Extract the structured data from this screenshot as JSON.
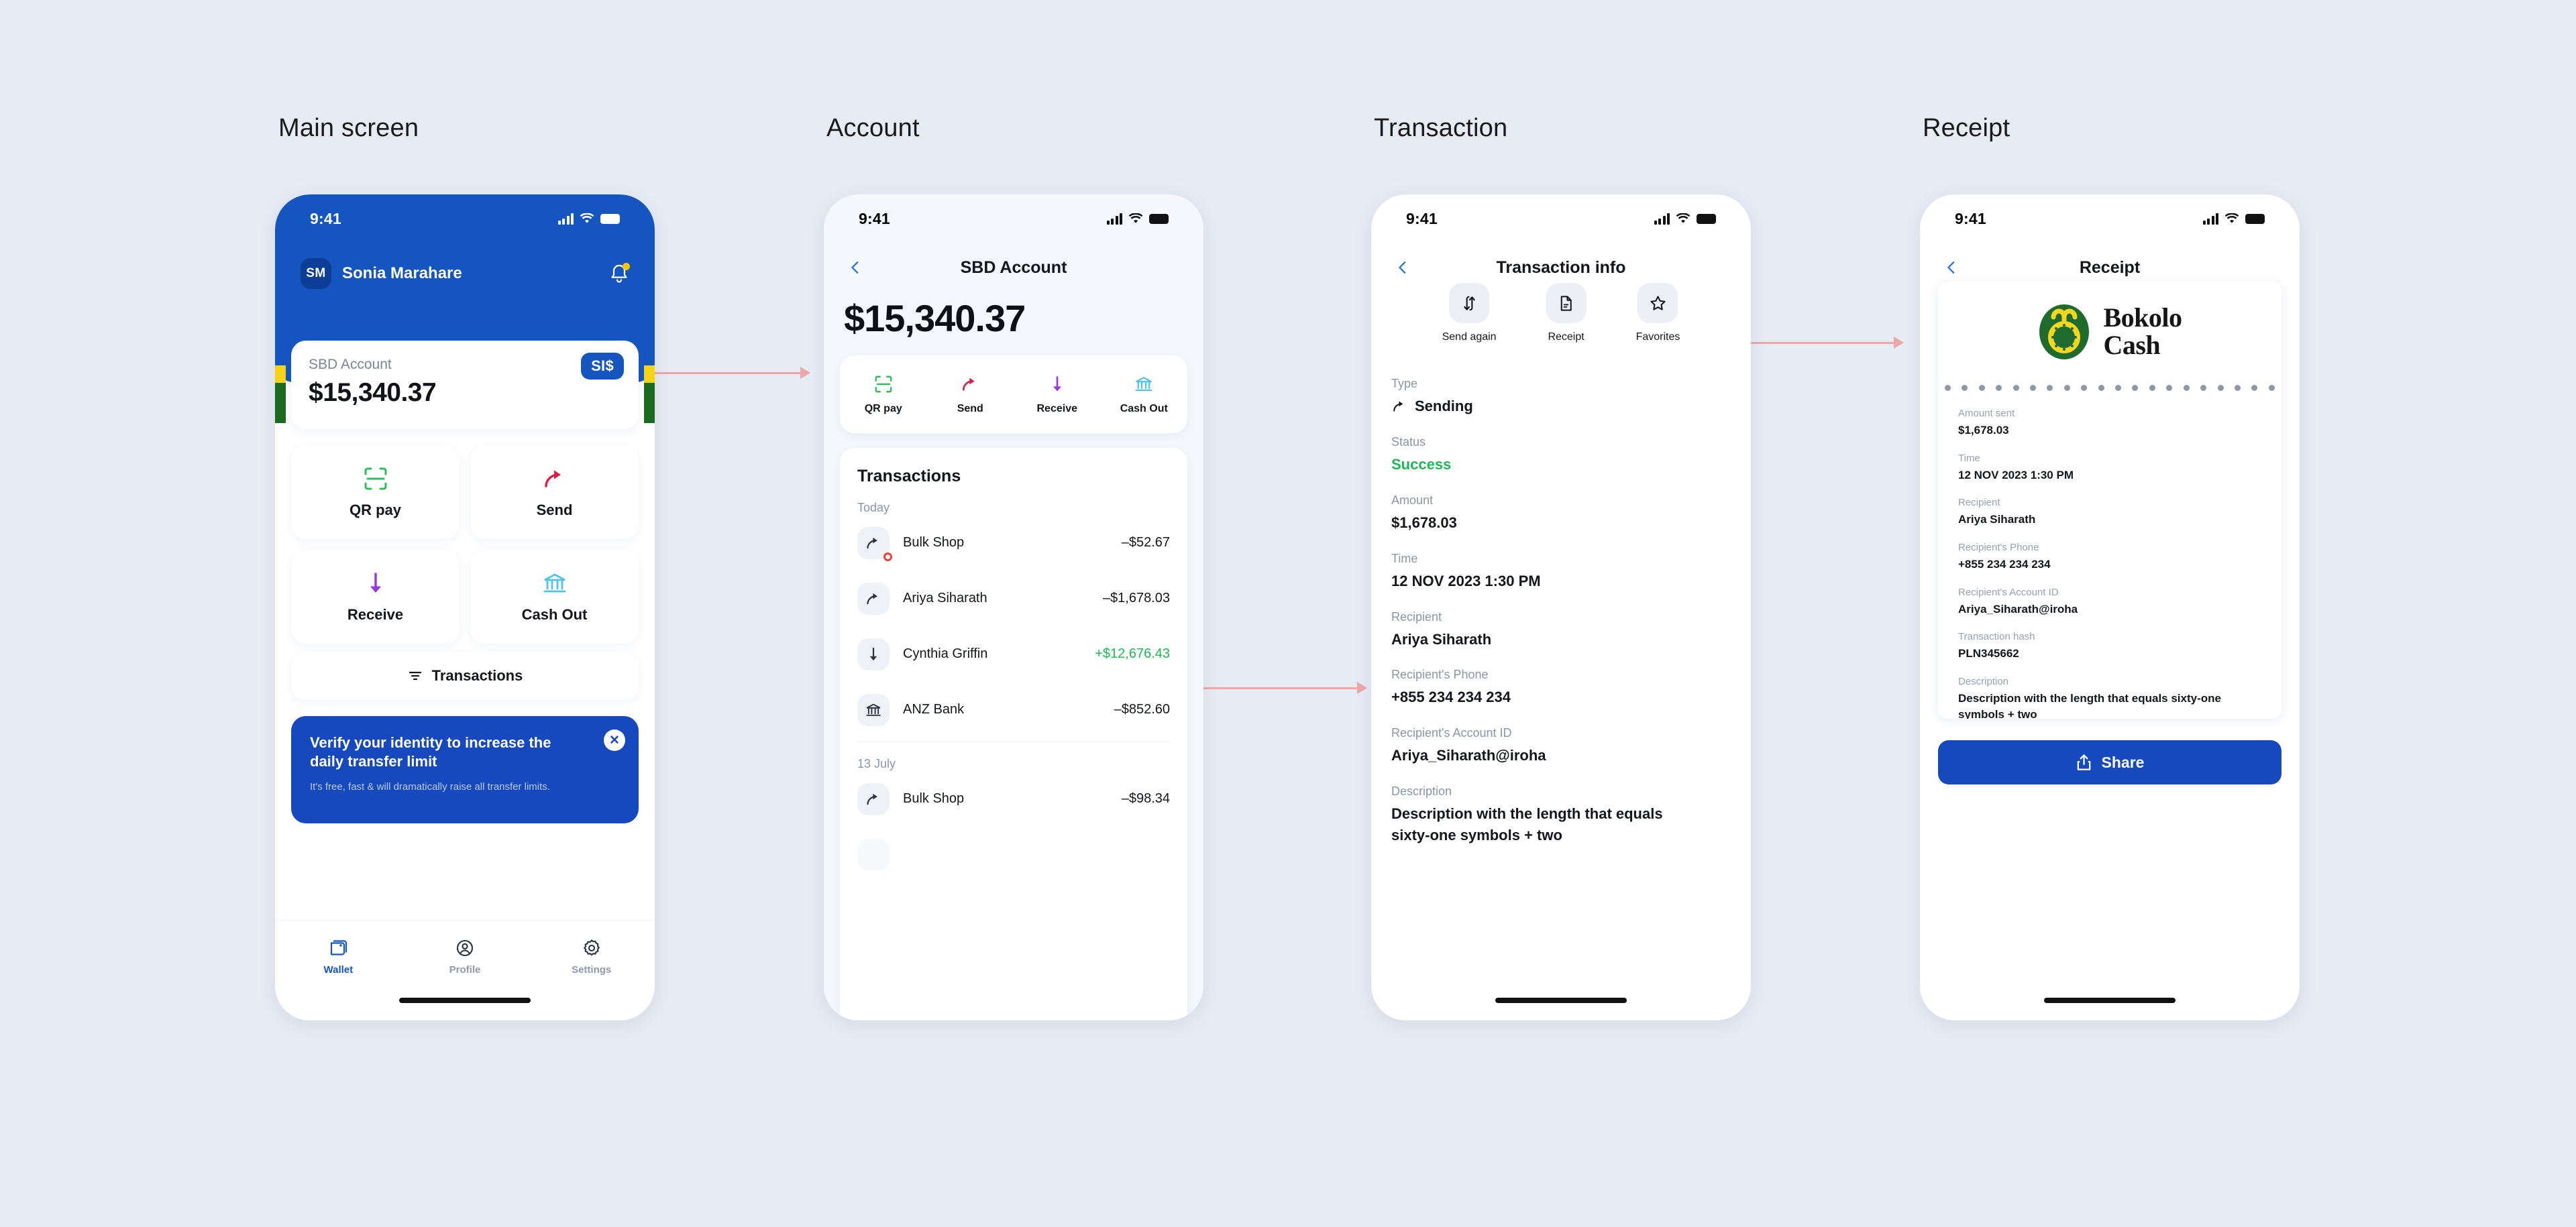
{
  "sections": [
    {
      "label": "Main screen"
    },
    {
      "label": "Account"
    },
    {
      "label": "Transaction"
    },
    {
      "label": "Receipt"
    }
  ],
  "colors": {
    "page_background": "#e6ebf4",
    "brand_blue": "#1555c0",
    "promo_blue": "#1649bd",
    "success_green": "#1db954",
    "arrow_pink": "#eda7a7",
    "flag_yellow": "#f5d312",
    "flag_green": "#1b6b1f",
    "logo_green": "#1f6b2e",
    "logo_yellow": "#f4d71d"
  },
  "status_bar": {
    "time": "9:41"
  },
  "main_screen": {
    "user": {
      "initials": "SM",
      "name": "Sonia Marahare"
    },
    "notification_icon": "bell-icon",
    "balance_card": {
      "account_label": "SBD Account",
      "amount": "$15,340.37",
      "currency_badge": "SI$"
    },
    "tiles": [
      {
        "label": "QR pay",
        "icon": "qr-scan-icon"
      },
      {
        "label": "Send",
        "icon": "send-arrow-icon"
      },
      {
        "label": "Receive",
        "icon": "receive-arrow-icon"
      },
      {
        "label": "Cash Out",
        "icon": "bank-icon"
      }
    ],
    "transactions_button": {
      "label": "Transactions",
      "icon": "filter-icon"
    },
    "promo": {
      "title": "Verify your identity to increase the daily transfer limit",
      "subtitle": "It's free, fast & will dramatically raise all transfer limits.",
      "close_icon": "close-icon"
    },
    "tab_bar": [
      {
        "label": "Wallet",
        "icon": "wallet-icon",
        "active": true
      },
      {
        "label": "Profile",
        "icon": "user-circle-icon",
        "active": false
      },
      {
        "label": "Settings",
        "icon": "gear-icon",
        "active": false
      }
    ]
  },
  "account_screen": {
    "title": "SBD Account",
    "back_icon": "chevron-left-icon",
    "balance": "$15,340.37",
    "actions": [
      {
        "label": "QR pay",
        "icon": "qr-scan-icon"
      },
      {
        "label": "Send",
        "icon": "send-arrow-icon"
      },
      {
        "label": "Receive",
        "icon": "receive-arrow-icon"
      },
      {
        "label": "Cash Out",
        "icon": "bank-icon"
      }
    ],
    "transactions_heading": "Transactions",
    "groups": [
      {
        "day": "Today",
        "rows": [
          {
            "name": "Bulk Shop",
            "amount": "–$52.67",
            "icon": "send-arrow-icon",
            "positive": false,
            "has_alert_dot": true
          },
          {
            "name": "Ariya Siharath",
            "amount": "–$1,678.03",
            "icon": "send-arrow-icon",
            "positive": false,
            "has_alert_dot": false
          },
          {
            "name": "Cynthia Griffin",
            "amount": "+$12,676.43",
            "icon": "receive-arrow-icon",
            "positive": true,
            "has_alert_dot": false
          },
          {
            "name": "ANZ Bank",
            "amount": "–$852.60",
            "icon": "bank-icon",
            "positive": false,
            "has_alert_dot": false
          }
        ]
      },
      {
        "day": "13 July",
        "rows": [
          {
            "name": "Bulk Shop",
            "amount": "–$98.34",
            "icon": "send-arrow-icon",
            "positive": false,
            "has_alert_dot": false
          }
        ]
      }
    ]
  },
  "transaction_screen": {
    "title": "Transaction info",
    "back_icon": "chevron-left-icon",
    "quick_actions": [
      {
        "label": "Send again",
        "icon": "repeat-icon"
      },
      {
        "label": "Receipt",
        "icon": "document-icon"
      },
      {
        "label": "Favorites",
        "icon": "star-icon"
      }
    ],
    "details": [
      {
        "label": "Type",
        "value": "Sending",
        "icon": "send-arrow-icon",
        "status": false
      },
      {
        "label": "Status",
        "value": "Success",
        "icon": null,
        "status": true
      },
      {
        "label": "Amount",
        "value": "$1,678.03",
        "icon": null,
        "status": false
      },
      {
        "label": "Time",
        "value": "12 NOV 2023 1:30 PM",
        "icon": null,
        "status": false
      },
      {
        "label": "Recipient",
        "value": "Ariya Siharath",
        "icon": null,
        "status": false
      },
      {
        "label": "Recipient's Phone",
        "value": "+855 234 234 234",
        "icon": null,
        "status": false
      },
      {
        "label": "Recipient's Account ID",
        "value": "Ariya_Siharath@iroha",
        "icon": null,
        "status": false
      },
      {
        "label": "Description",
        "value": "Description with the length that equals sixty-one symbols + two",
        "icon": null,
        "status": false
      }
    ]
  },
  "receipt_screen": {
    "title": "Receipt",
    "back_icon": "chevron-left-icon",
    "brand": {
      "line1": "Bokolo",
      "line2": "Cash",
      "logo_icon": "bokolo-ring-logo"
    },
    "fields": [
      {
        "label": "Amount sent",
        "value": "$1,678.03"
      },
      {
        "label": "Time",
        "value": "12 NOV 2023 1:30 PM"
      },
      {
        "label": "Recipient",
        "value": "Ariya Siharath"
      },
      {
        "label": "Recipient's Phone",
        "value": "+855 234 234 234"
      },
      {
        "label": "Recipient's Account ID",
        "value": "Ariya_Siharath@iroha"
      },
      {
        "label": "Transaction hash",
        "value": "PLN345662"
      },
      {
        "label": "Description",
        "value": "Description with the length that equals sixty-one symbols + two"
      }
    ],
    "share_button": {
      "label": "Share",
      "icon": "share-icon"
    }
  }
}
